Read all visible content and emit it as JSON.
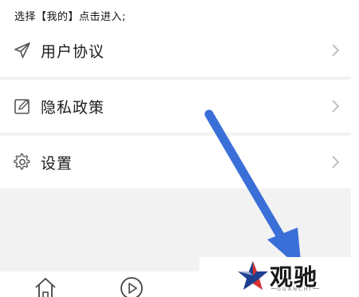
{
  "instruction": "选择【我的】点击进入;",
  "menu": [
    {
      "label": "用户协议",
      "icon": "send-icon"
    },
    {
      "label": "隐私政策",
      "icon": "edit-icon"
    },
    {
      "label": "设置",
      "icon": "gear-icon"
    }
  ],
  "tabbar": [
    {
      "icon": "home-icon"
    },
    {
      "icon": "play-icon"
    }
  ],
  "watermark": {
    "text": "观驰",
    "subtext": "GUANCHI"
  },
  "annotation": {
    "color": "#3a6fd8"
  }
}
